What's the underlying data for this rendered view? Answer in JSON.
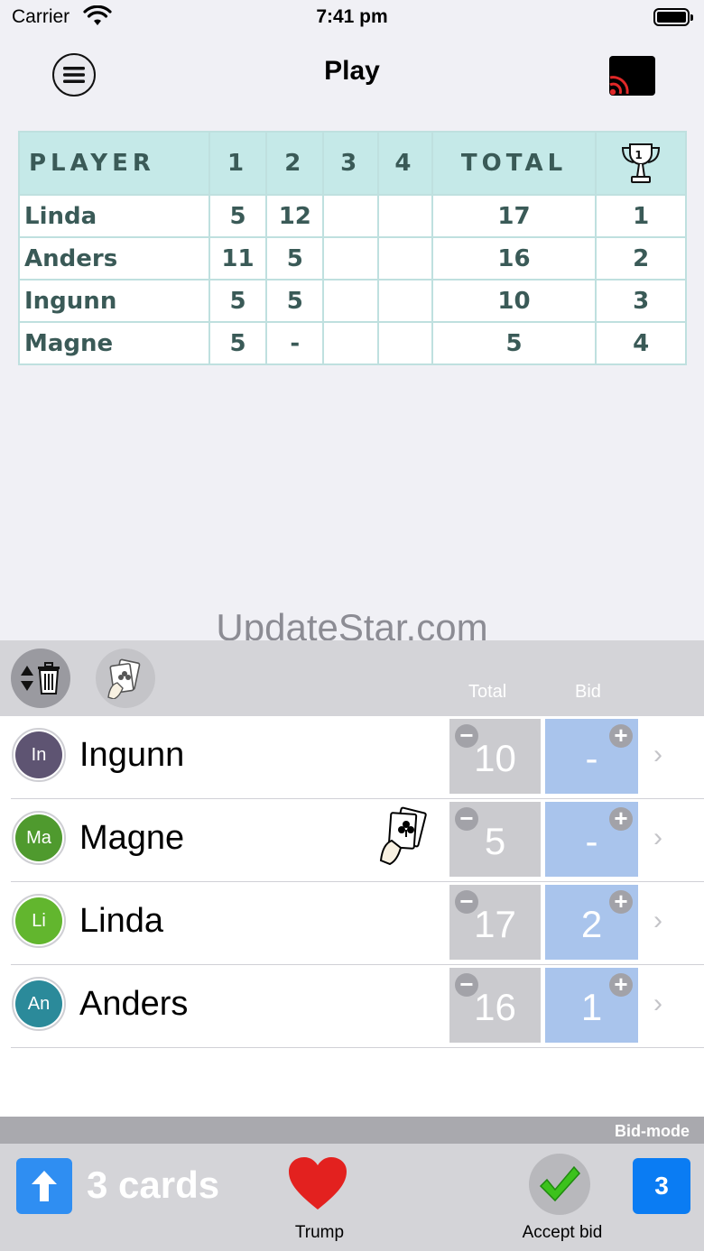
{
  "status_bar": {
    "carrier": "Carrier",
    "time": "7:41 pm"
  },
  "nav": {
    "title": "Play"
  },
  "score_table": {
    "headers": [
      "PLAYER",
      "1",
      "2",
      "3",
      "4",
      "TOTAL"
    ],
    "trophy_icon": "trophy-icon",
    "rows": [
      {
        "name": "Linda",
        "r1": "5",
        "r2": "12",
        "r3": "",
        "r4": "",
        "total": "17",
        "place": "1"
      },
      {
        "name": "Anders",
        "r1": "11",
        "r2": "5",
        "r3": "",
        "r4": "",
        "total": "16",
        "place": "2"
      },
      {
        "name": "Ingunn",
        "r1": "5",
        "r2": "5",
        "r3": "",
        "r4": "",
        "total": "10",
        "place": "3"
      },
      {
        "name": "Magne",
        "r1": "5",
        "r2": "-",
        "r3": "",
        "r4": "",
        "total": "5",
        "place": "4"
      }
    ]
  },
  "watermark": "UpdateStar.com",
  "panel": {
    "total_header": "Total",
    "bid_header": "Bid"
  },
  "players": [
    {
      "initials": "In",
      "name": "Ingunn",
      "total": "10",
      "bid": "-",
      "color": "#5e5472",
      "dealer": false
    },
    {
      "initials": "Ma",
      "name": "Magne",
      "total": "5",
      "bid": "-",
      "color": "#4f9a2e",
      "dealer": true
    },
    {
      "initials": "Li",
      "name": "Linda",
      "total": "17",
      "bid": "2",
      "color": "#62b62e",
      "dealer": false
    },
    {
      "initials": "An",
      "name": "Anders",
      "total": "16",
      "bid": "1",
      "color": "#2b8a9a",
      "dealer": false
    }
  ],
  "mode_label": "Bid-mode",
  "toolbar": {
    "cards_label": "3 cards",
    "trump_label": "Trump",
    "accept_label": "Accept bid",
    "round_number": "3"
  },
  "colors": {
    "table_header": "#c5e9e8",
    "table_text": "#3a5a57",
    "bid_cell": "#a9c4ec",
    "total_cell": "#cbcbcf",
    "accent_blue": "#0a7cf3",
    "trump_red": "#e3211f",
    "accept_green": "#3cc21c"
  }
}
